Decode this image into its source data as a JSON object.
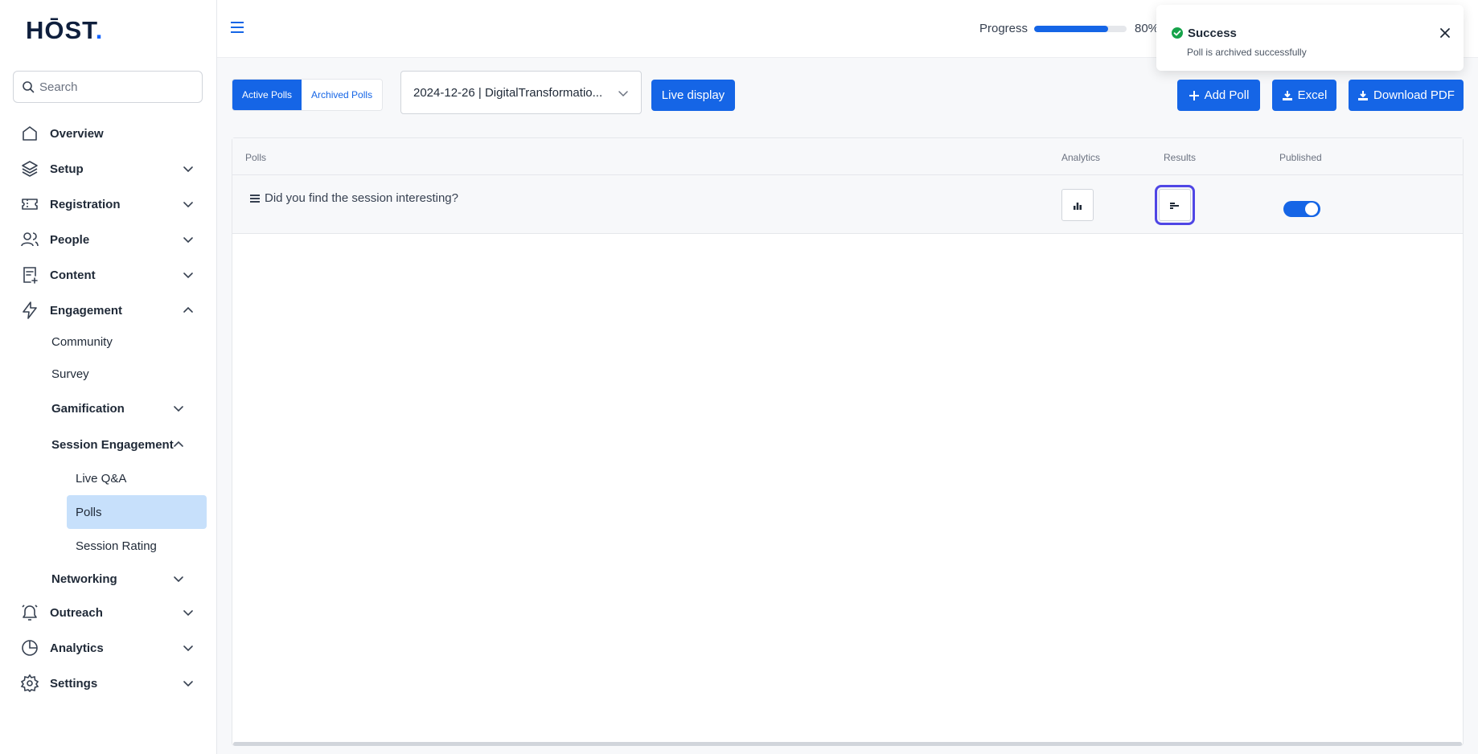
{
  "brand": {
    "logo_main": "HŌST",
    "logo_dot": "."
  },
  "search": {
    "placeholder": "Search"
  },
  "sidebar": {
    "items": [
      {
        "label": "Overview"
      },
      {
        "label": "Setup"
      },
      {
        "label": "Registration"
      },
      {
        "label": "People"
      },
      {
        "label": "Content"
      },
      {
        "label": "Engagement"
      },
      {
        "label": "Outreach"
      },
      {
        "label": "Analytics"
      },
      {
        "label": "Settings"
      }
    ],
    "engagement_children": [
      {
        "label": "Community"
      },
      {
        "label": "Survey"
      },
      {
        "label": "Gamification"
      },
      {
        "label": "Session Engagement"
      },
      {
        "label": "Networking"
      }
    ],
    "session_engagement_children": [
      {
        "label": "Live Q&A"
      },
      {
        "label": "Polls"
      },
      {
        "label": "Session Rating"
      }
    ],
    "active_item": "Polls"
  },
  "topbar": {
    "progress_label": "Progress",
    "progress_value": 0.8,
    "progress_text": "80%"
  },
  "toast": {
    "title": "Success",
    "message": "Poll is archived successfully"
  },
  "toolbar": {
    "tab_active": "Active Polls",
    "tab_archived": "Archived Polls",
    "session_select": "2024-12-26 | DigitalTransformatio...",
    "live_display": "Live display",
    "add_poll": "Add Poll",
    "excel": "Excel",
    "download_pdf": "Download PDF"
  },
  "table": {
    "headers": {
      "polls": "Polls",
      "analytics": "Analytics",
      "results": "Results",
      "published": "Published"
    },
    "rows": [
      {
        "question": "Did you find the session interesting?",
        "published": true
      }
    ]
  },
  "colors": {
    "accent": "#1565e6",
    "active_nav_bg": "#c7e0fb",
    "success": "#16a34a"
  }
}
